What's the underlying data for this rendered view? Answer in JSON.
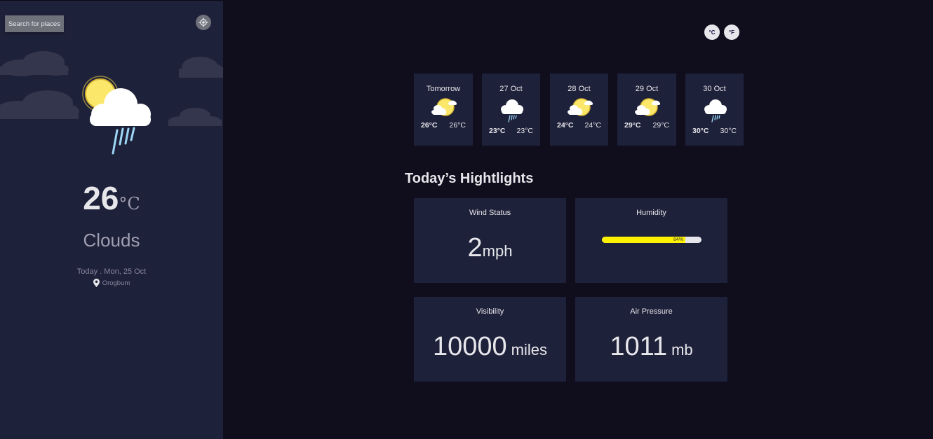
{
  "sidebar": {
    "search_label": "Search for places",
    "locate_icon": "crosshair-icon",
    "weather_icon": "sun-cloud-rain-icon",
    "temperature": "26",
    "temperature_unit": "°C",
    "condition": "Clouds",
    "date": "Today . Mon, 25 Oct",
    "location_icon": "map-pin-icon",
    "location": "Orogbum"
  },
  "units": {
    "celsius_label": "°C",
    "fahrenheit_label": "°F"
  },
  "forecast": [
    {
      "day": "Tomorrow",
      "icon": "sun-cloud-icon",
      "high": "26°C",
      "low": "26°C"
    },
    {
      "day": "27 Oct",
      "icon": "cloud-rain-icon",
      "high": "23°C",
      "low": "23°C"
    },
    {
      "day": "28 Oct",
      "icon": "sun-cloud-icon",
      "high": "24°C",
      "low": "24°C"
    },
    {
      "day": "29 Oct",
      "icon": "sun-cloud-icon",
      "high": "29°C",
      "low": "29°C"
    },
    {
      "day": "30 Oct",
      "icon": "cloud-rain-icon",
      "high": "30°C",
      "low": "30°C"
    }
  ],
  "highlights": {
    "title": "Today’s Hightlights",
    "wind": {
      "label": "Wind Status",
      "value": "2",
      "unit": "mph"
    },
    "humidity": {
      "label": "Humidity",
      "percent": 84,
      "percent_label": "84%"
    },
    "visibility": {
      "label": "Visibility",
      "value": "10000",
      "unit": "miles"
    },
    "pressure": {
      "label": "Air Pressure",
      "value": "1011",
      "unit": "mb"
    }
  },
  "colors": {
    "sidebar_bg": "#1e213a",
    "main_bg": "#100e1d",
    "card_bg": "#1e213a",
    "humidity_fill": "#fff200",
    "text": "#e7e7eb",
    "muted": "#a09fb1"
  }
}
